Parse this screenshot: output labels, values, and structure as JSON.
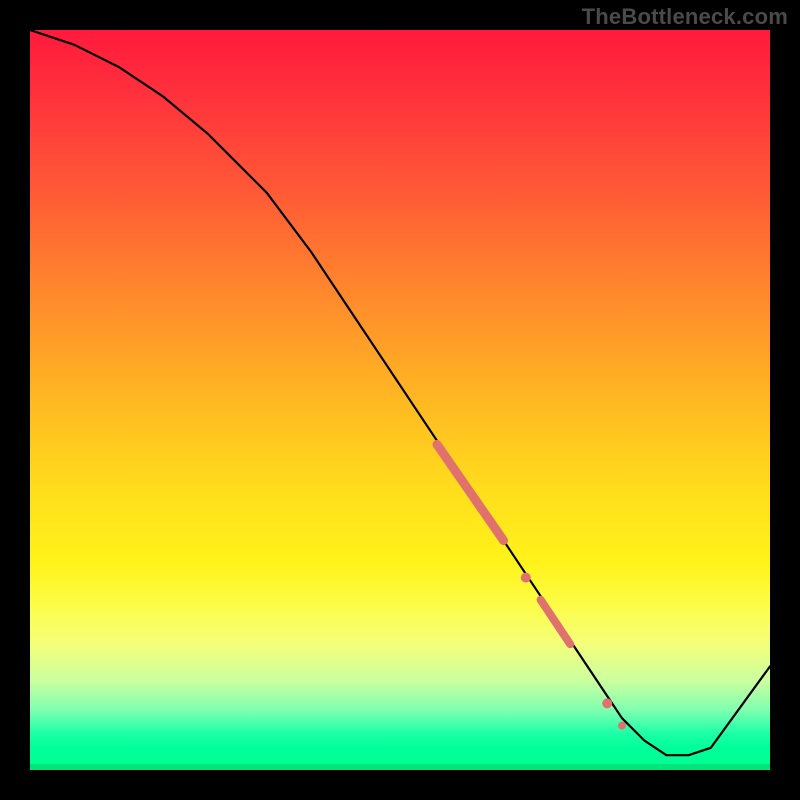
{
  "watermark": "TheBottleneck.com",
  "chart_data": {
    "type": "line",
    "title": "",
    "xlabel": "",
    "ylabel": "",
    "xlim": [
      0,
      100
    ],
    "ylim": [
      0,
      100
    ],
    "grid": false,
    "legend": false,
    "series": [
      {
        "name": "curve",
        "x": [
          0,
          6,
          12,
          18,
          24,
          28,
          32,
          38,
          44,
          50,
          56,
          62,
          66,
          70,
          74,
          78,
          80,
          83,
          86,
          89,
          92,
          100
        ],
        "y": [
          100,
          98,
          95,
          91,
          86,
          82,
          78,
          70,
          61,
          52,
          43,
          34,
          28,
          22,
          16,
          10,
          7,
          4,
          2,
          2,
          3,
          14
        ]
      }
    ],
    "markers": [
      {
        "kind": "segment",
        "x0": 55,
        "y0": 44,
        "x1": 64,
        "y1": 31,
        "width": 9
      },
      {
        "kind": "dot",
        "x": 67,
        "y": 26,
        "r": 5
      },
      {
        "kind": "segment",
        "x0": 69,
        "y0": 23,
        "x1": 73,
        "y1": 17,
        "width": 8
      },
      {
        "kind": "dot",
        "x": 78,
        "y": 9,
        "r": 5
      },
      {
        "kind": "dot",
        "x": 80,
        "y": 6,
        "r": 4
      }
    ],
    "colors": {
      "curve": "#000000",
      "marker": "#e0716c",
      "gradient_top": "#ff1a3c",
      "gradient_mid": "#fff31a",
      "gradient_bottom": "#00ff90"
    }
  }
}
